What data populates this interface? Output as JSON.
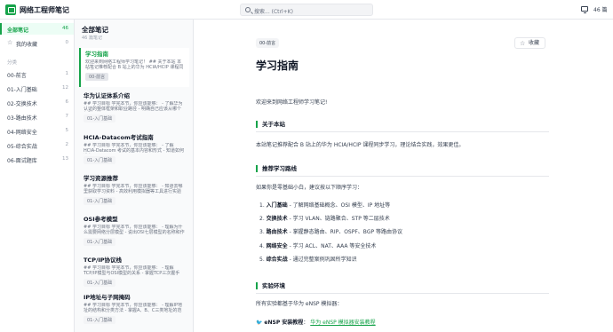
{
  "app": {
    "title": "网络工程师笔记"
  },
  "search": {
    "placeholder": "搜索... (Ctrl+K)"
  },
  "header": {
    "note_count": "46 篇"
  },
  "sidebar": {
    "all_notes": {
      "label": "全部笔记",
      "count": "46"
    },
    "favorites": {
      "label": "我的收藏",
      "count": "0"
    },
    "section_label": "分类",
    "categories": [
      {
        "label": "00-前言",
        "count": "1"
      },
      {
        "label": "01-入门基础",
        "count": "12"
      },
      {
        "label": "02-交换技术",
        "count": "6"
      },
      {
        "label": "03-路由技术",
        "count": "7"
      },
      {
        "label": "04-网络安全",
        "count": "5"
      },
      {
        "label": "05-综合实战",
        "count": "2"
      },
      {
        "label": "06-面试题库",
        "count": "13"
      }
    ]
  },
  "notelist": {
    "title": "全部笔记",
    "subtitle": "46 篇笔记",
    "notes": [
      {
        "title": "学习指南",
        "excerpt": "欢迎来到网络工程师学习笔记！ ## 关于本站 本站笔记推荐配合 B 站上的华为 HCIA/HCIP 课程同步学习",
        "tag": "00-前言"
      },
      {
        "title": "华为认证体系介绍",
        "excerpt": "## 学习目标 学完本节，你应该能够： - 了解华为认证的整体框架和职业路径 - 明确自己应该从哪个级别开始",
        "tag": "01-入门基础"
      },
      {
        "title": "HCIA-Datacom考试指南",
        "excerpt": "## 学习目标 学完本节，你应该能够： - 了解 HCIA-Datacom 考试的基本内容和形式 - 知道如何准备",
        "tag": "01-入门基础"
      },
      {
        "title": "学习资源推荐",
        "excerpt": "## 学习目标 学完本节，你应该能够： - 知道去哪里获取学习资料 - 高效利用模拟器等工具进行实验",
        "tag": "01-入门基础"
      },
      {
        "title": "OSI参考模型",
        "excerpt": "## 学习目标 学完本节，你应该能够： - 理解为什么需要网络分层模型 - 说出OSI七层模型的名称和作用",
        "tag": "01-入门基础"
      },
      {
        "title": "TCP/IP协议栈",
        "excerpt": "## 学习目标 学完本节，你应该能够： - 理解 TCP/IP模型与OSI模型的关系 - 掌握TCP三次握手",
        "tag": "01-入门基础"
      },
      {
        "title": "IP地址与子网掩码",
        "excerpt": "## 学习目标 学完本节，你应该能够： - 理解IP地址的结构和分类方法 - 掌握A、B、C三类地址的范围",
        "tag": "01-入门基础"
      }
    ]
  },
  "main": {
    "category": "00-前言",
    "favorite_label": "收藏",
    "title": "学习指南",
    "welcome": "欢迎来到网络工程师学习笔记!",
    "h_about": "关于本站",
    "about_text": "本站笔记推荐配合 B 站上的华为 HCIA/HCIP 课程同步学习，理论结合实践，效果更佳。",
    "h_route": "推荐学习路线",
    "route_intro": "如果你是零基础小白，建议按以下顺序学习：",
    "route_items": [
      {
        "num": "1.",
        "name": "入门基础",
        "desc": " - 了解网络基础概念、OSI 模型、IP 地址等"
      },
      {
        "num": "2.",
        "name": "交换技术",
        "desc": " - 学习 VLAN、链路聚合、STP 等二层技术"
      },
      {
        "num": "3.",
        "name": "路由技术",
        "desc": " - 掌握静态路由、RIP、OSPF、BGP 等路由协议"
      },
      {
        "num": "4.",
        "name": "网络安全",
        "desc": " - 学习 ACL、NAT、AAA 等安全技术"
      },
      {
        "num": "5.",
        "name": "综合实战",
        "desc": " - 通过完整案例巩固所学知识"
      }
    ],
    "h_lab": "实验环境",
    "lab_intro": "所有实验都基于华为 eNSP 模拟器：",
    "lab_link_label": "eNSP 安装教程",
    "lab_link_sep": "：",
    "lab_link_text": "华为 eNSP 模拟器安装教程"
  },
  "colors": {
    "accent": "#16a34a",
    "text": "#1f2937",
    "muted": "#9ca3af"
  }
}
